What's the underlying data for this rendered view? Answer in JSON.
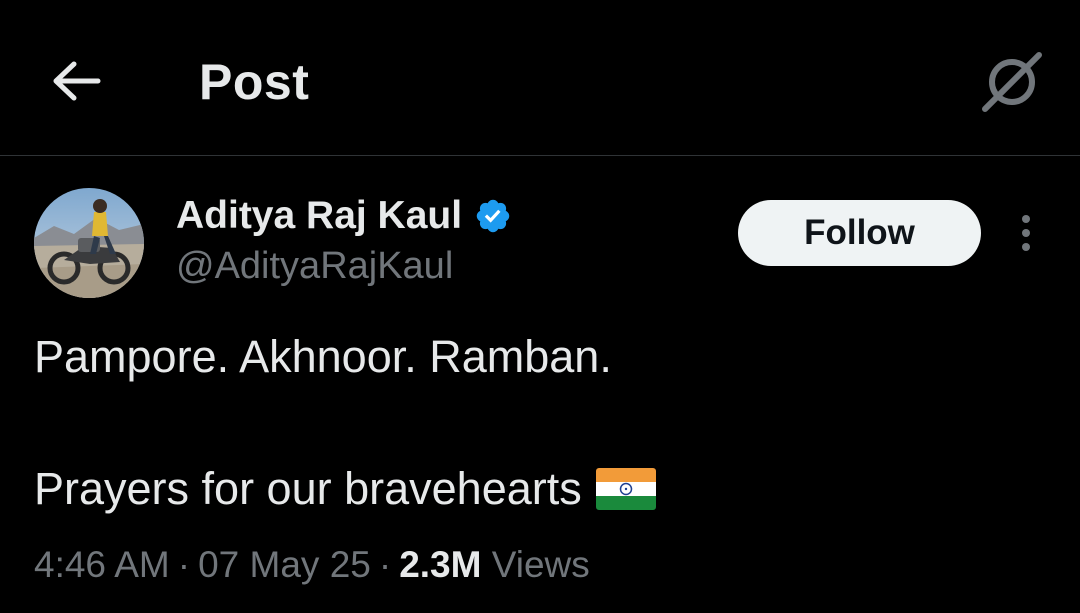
{
  "header": {
    "back_icon": "arrow-left-icon",
    "title": "Post",
    "grok_icon": "grok-icon"
  },
  "tweet": {
    "author": {
      "name": "Aditya Raj Kaul",
      "handle": "@AdityaRajKaul",
      "verified": true,
      "verified_color": "#1d9bf0"
    },
    "follow_label": "Follow",
    "more_icon": "more-vertical-icon",
    "text_line1": "Pampore. Akhnoor. Ramban.",
    "text_line2": "Prayers for our bravehearts",
    "emoji": "india-flag-emoji",
    "meta": {
      "time": "4:46 AM",
      "separator": "·",
      "date": "07 May 25",
      "views_count": "2.3M",
      "views_label": "Views"
    }
  },
  "colors": {
    "background": "#000000",
    "text_primary": "#e7e9ea",
    "text_secondary": "#71767b",
    "divider": "#2f3336",
    "follow_bg": "#eff3f4",
    "follow_text": "#0f1419",
    "verified": "#1d9bf0"
  }
}
